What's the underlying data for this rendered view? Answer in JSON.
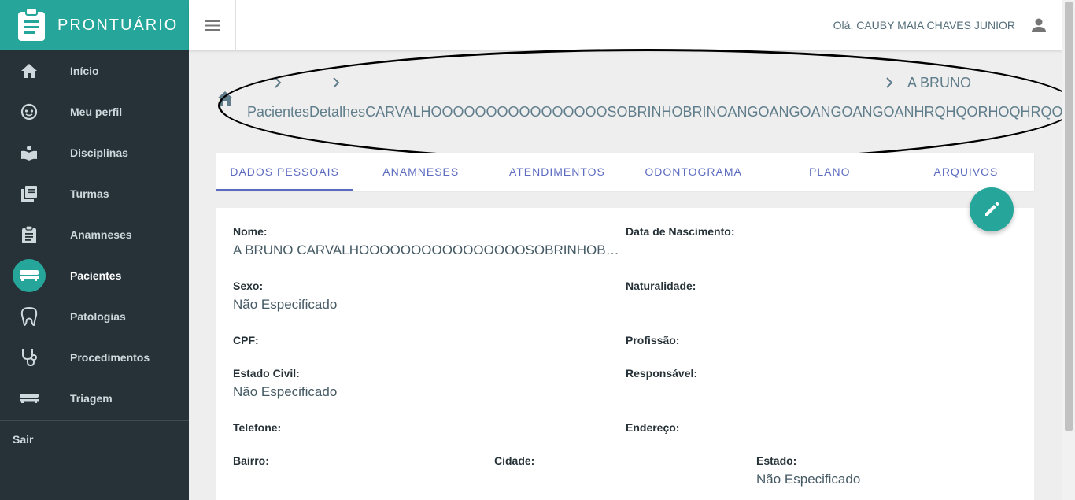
{
  "app": {
    "title": "PRONTUÁRIO"
  },
  "sidebar": {
    "items": [
      {
        "label": "Início",
        "icon": "home-icon"
      },
      {
        "label": "Meu perfil",
        "icon": "face-icon"
      },
      {
        "label": "Disciplinas",
        "icon": "book-icon"
      },
      {
        "label": "Turmas",
        "icon": "library-icon"
      },
      {
        "label": "Anamneses",
        "icon": "clipboard-icon"
      },
      {
        "label": "Pacientes",
        "icon": "bed-icon",
        "active": true
      },
      {
        "label": "Patologias",
        "icon": "tooth-icon"
      },
      {
        "label": "Procedimentos",
        "icon": "stethoscope-icon"
      },
      {
        "label": "Triagem",
        "icon": "stretcher-icon"
      }
    ],
    "logout": "Sair"
  },
  "header": {
    "greeting": "Olá, CAUBY MAIA CHAVES JUNIOR"
  },
  "breadcrumb": {
    "first_line": "A BRUNO",
    "second_line": "PacientesDetalhesCARVALHOOOOOOOOOOOOOOOOSOBRINHOBRINOANGOANGOANGOANGOANHRQHQORHOQHRQOWORTW"
  },
  "tabs": [
    "DADOS PESSOAIS",
    "ANAMNESES",
    "ATENDIMENTOS",
    "ODONTOGRAMA",
    "PLANO",
    "ARQUIVOS"
  ],
  "patient": {
    "nome_label": "Nome:",
    "nome_value": "A BRUNO CARVALHOOOOOOOOOOOOOOOOSOBRINHOBRINOANGOANGOANGOANGOANHRQHQORHOQHRQOWORTW",
    "nascimento_label": "Data de Nascimento:",
    "sexo_label": "Sexo:",
    "sexo_value": "Não Especificado",
    "naturalidade_label": "Naturalidade:",
    "cpf_label": "CPF:",
    "profissao_label": "Profissão:",
    "estado_civil_label": "Estado Civil:",
    "estado_civil_value": "Não Especificado",
    "responsavel_label": "Responsável:",
    "telefone_label": "Telefone:",
    "endereco_label": "Endereço:",
    "bairro_label": "Bairro:",
    "cidade_label": "Cidade:",
    "estado_label": "Estado:",
    "estado_value": "Não Especificado"
  },
  "colors": {
    "primary": "#26a69a",
    "sidebar": "#263238",
    "tab": "#5c6bc0"
  }
}
